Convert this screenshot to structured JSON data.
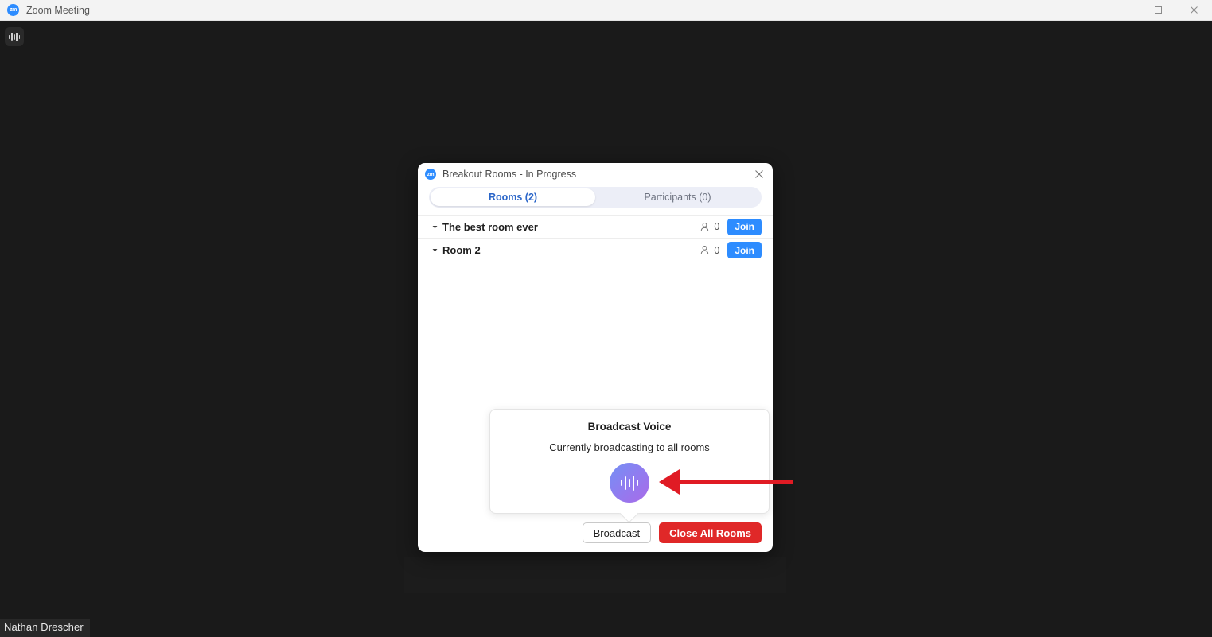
{
  "window": {
    "title": "Zoom Meeting",
    "logo_text": "zm",
    "controls": [
      {
        "name": "minimize",
        "label": "Minimize"
      },
      {
        "name": "maximize",
        "label": "Maximize"
      },
      {
        "name": "close",
        "label": "Close"
      }
    ]
  },
  "stage": {
    "self_name": "Nathan Drescher",
    "audio_indicator": "audio-waveform-icon"
  },
  "dialog": {
    "logo_text": "zm",
    "title": "Breakout Rooms - In Progress",
    "close_label": "×",
    "tabs": [
      {
        "label": "Rooms (2)",
        "active": true
      },
      {
        "label": "Participants (0)",
        "active": false
      }
    ],
    "rooms": [
      {
        "name": "The best room ever",
        "count": "0",
        "join_label": "Join",
        "expanded": true
      },
      {
        "name": "Room 2",
        "count": "0",
        "join_label": "Join",
        "expanded": true
      }
    ],
    "broadcast_popup": {
      "title": "Broadcast Voice",
      "subtitle": "Currently broadcasting to all rooms",
      "mic_icon": "audio-waveform-icon"
    },
    "footer": {
      "broadcast_label": "Broadcast",
      "close_all_label": "Close All Rooms"
    }
  },
  "annotation": {
    "arrow_color": "#e01b24",
    "points_to": "broadcast-voice-indicator"
  },
  "colors": {
    "accent_blue": "#2d8cff",
    "tab_active_text": "#2b66c9",
    "danger_red": "#e02828",
    "stage_bg": "#1a1a1a",
    "titlebar_bg": "#f3f3f3",
    "gradient_start": "#7490f4",
    "gradient_end": "#a96ae8"
  }
}
